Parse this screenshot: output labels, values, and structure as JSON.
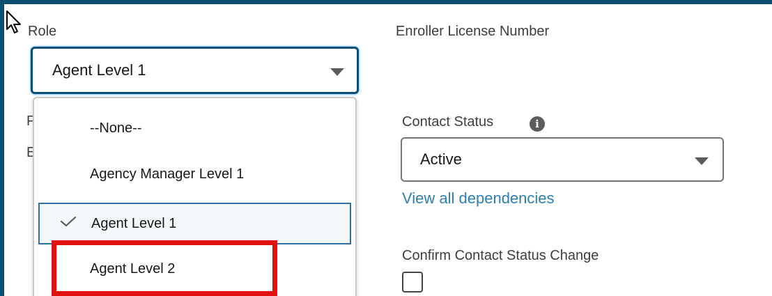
{
  "form": {
    "role_label": "Role",
    "role_value": "Agent Level 1",
    "enroller_label": "Enroller License Number",
    "contact_status_label": "Contact Status",
    "contact_status_value": "Active",
    "dependencies_link": "View all dependencies",
    "confirm_label": "Confirm Contact Status Change",
    "partial_labels": [
      "P",
      "E"
    ]
  },
  "role_dropdown": {
    "options": [
      "--None--",
      "Agency Manager Level 1",
      "Agent Level 1",
      "Agent Level 2"
    ],
    "selected": "Agent Level 1",
    "highlighted": "Agent Level 2"
  },
  "icons": {
    "info": "info-icon",
    "check": "check-icon",
    "caret": "chevron-down-icon",
    "cursor": "mouse-pointer-icon"
  },
  "colors": {
    "frame": "#0d4f73",
    "link": "#2c7fb0",
    "highlight": "#e21111",
    "selected_border": "#2d6fa6"
  }
}
